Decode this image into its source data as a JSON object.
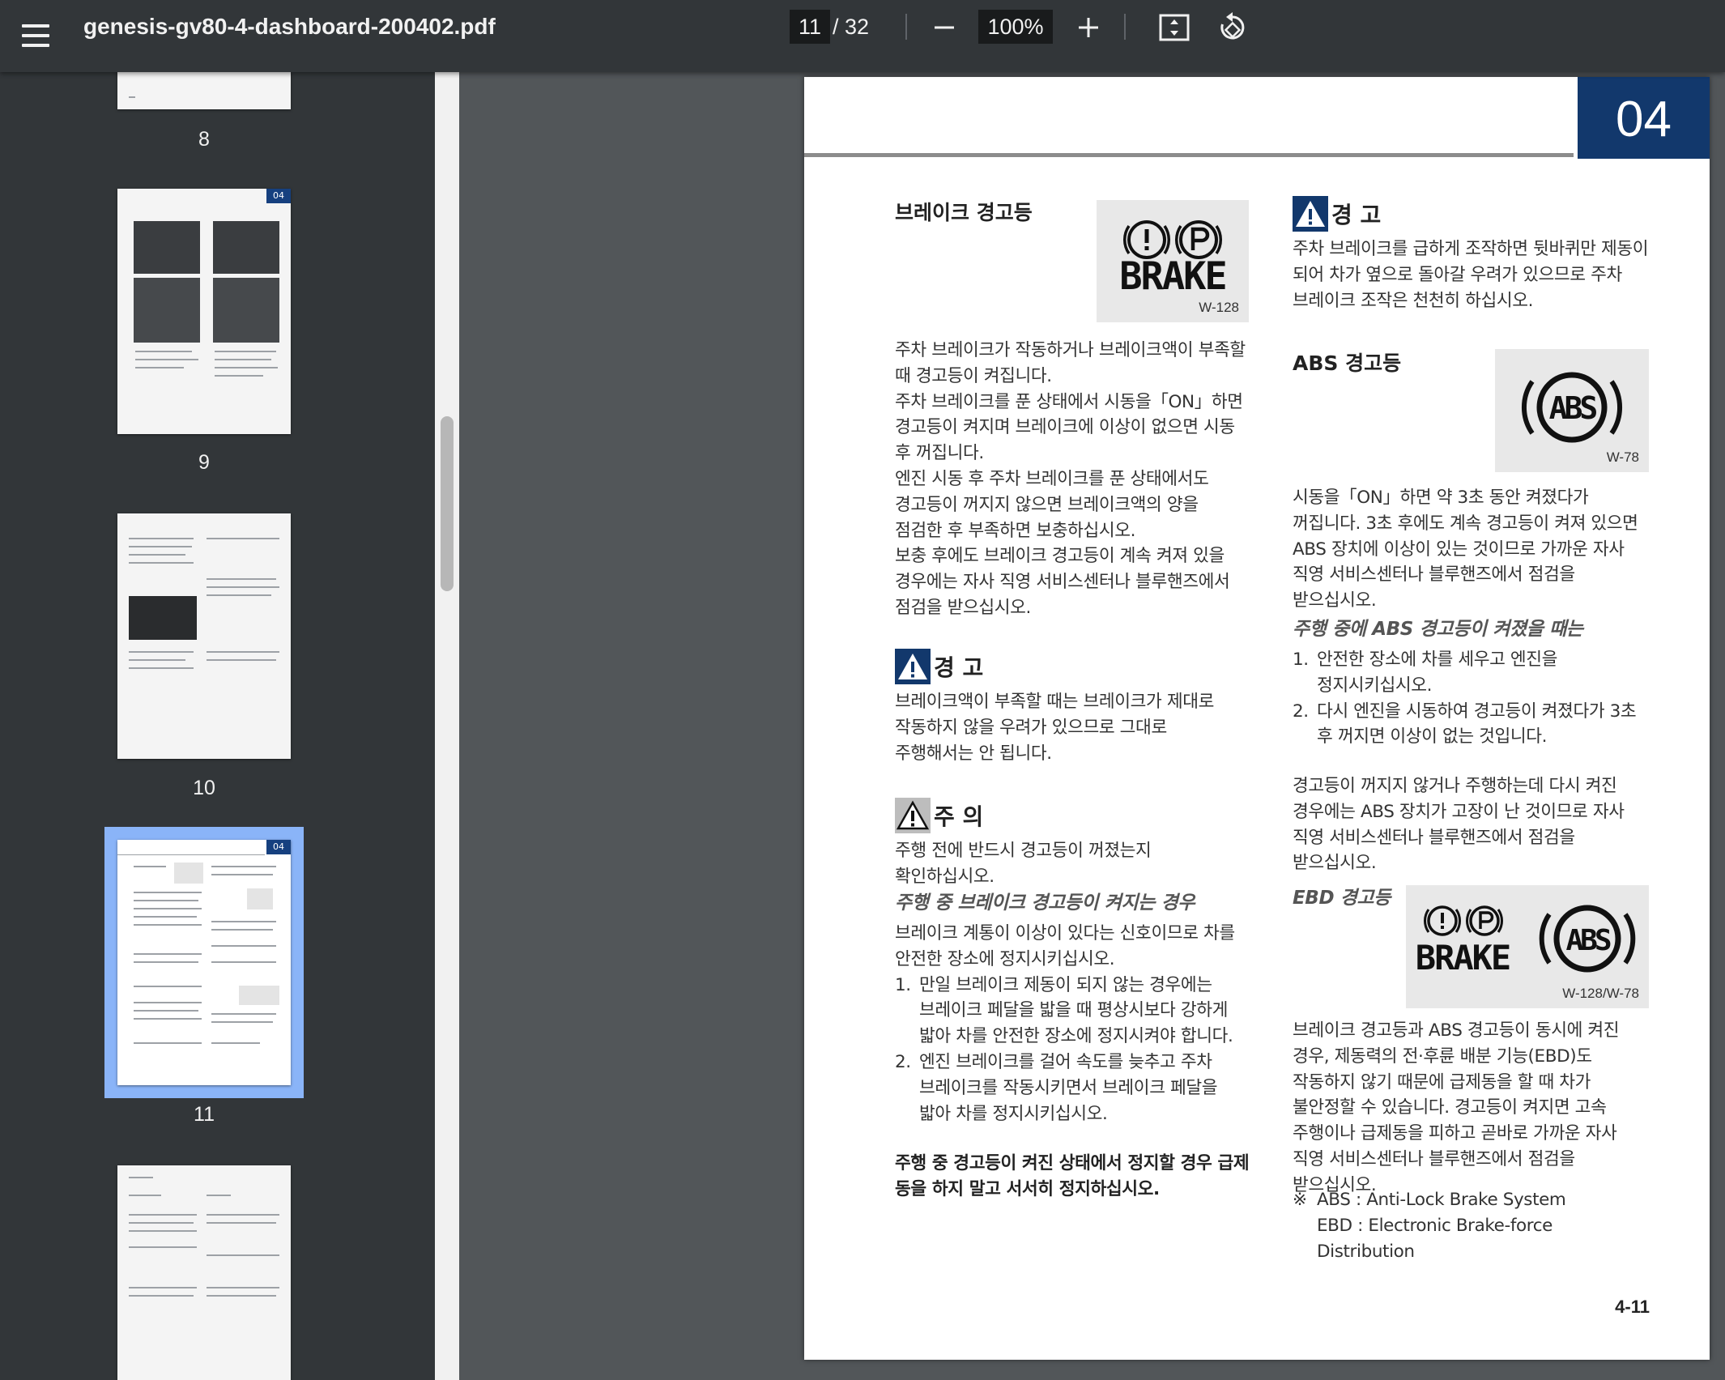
{
  "toolbar": {
    "title": "genesis-gv80-4-dashboard-200402.pdf",
    "current_page": "11",
    "total_pages": "/ 32",
    "zoom": "100%",
    "icons": [
      "menu-icon",
      "minus-icon",
      "plus-icon",
      "fit-page-icon",
      "rotate-icon"
    ]
  },
  "sidebar": {
    "thumbnails": [
      {
        "label": "8"
      },
      {
        "label": "9",
        "badge": "04"
      },
      {
        "label": "10"
      },
      {
        "label": "11",
        "badge": "04",
        "selected": true
      },
      {
        "label": ""
      }
    ]
  },
  "page": {
    "chapter": "04",
    "page_number": "4-11",
    "brake": {
      "title": "브레이크 경고등",
      "icon_text": "BRAKE",
      "icon_code": "W-128",
      "body": [
        "주차 브레이크가 작동하거나 브레이크액이 부족할 때 경고등이 켜집니다.",
        "주차 브레이크를 푼 상태에서 시동을「ON」하면 경고등이 켜지며 브레이크에 이상이 없으면 시동 후 꺼집니다.",
        "엔진 시동 후 주차 브레이크를 푼 상태에서도 경고등이 꺼지지 않으면 브레이크액의 양을 점검한 후 부족하면 보충하십시오.",
        "보충 후에도 브레이크 경고등이 계속 켜져 있을 경우에는 자사 직영 서비스센터나 블루핸즈에서 점검을 받으십시오."
      ]
    },
    "warning_left": {
      "title": "경 고",
      "body": "브레이크액이 부족할 때는 브레이크가 제대로 작동하지 않을 우려가 있으므로 그대로 주행해서는 안 됩니다."
    },
    "caution": {
      "title": "주 의",
      "body": "주행 전에 반드시 경고등이 꺼졌는지 확인하십시오."
    },
    "driving_brake": {
      "title": "주행 중 브레이크 경고등이 켜지는 경우",
      "body": "브레이크 계통이 이상이 있다는 신호이므로 차를 안전한 장소에 정지시키십시오.",
      "items": [
        {
          "num": "1.",
          "text": "만일 브레이크 제동이 되지 않는 경우에는 브레이크 페달을 밟을 때 평상시보다 강하게 밟아 차를 안전한 장소에 정지시켜야 합니다."
        },
        {
          "num": "2.",
          "text": "엔진 브레이크를 걸어 속도를 늦추고 주차 브레이크를 작동시키면서 브레이크 페달을 밟아 차를 정지시키십시오."
        }
      ],
      "bold_note": "주행 중 경고등이 켜진 상태에서 정지할 경우 급제동을 하지 말고 서서히 정지하십시오."
    },
    "warning_right": {
      "title": "경 고",
      "body": "주차 브레이크를 급하게 조작하면 뒷바퀴만 제동이 되어 차가 옆으로 돌아갈 우려가 있으므로 주차 브레이크 조작은 천천히 하십시오."
    },
    "abs": {
      "title": "ABS 경고등",
      "icon_text": "ABS",
      "icon_code": "W-78",
      "body": "시동을「ON」하면 약 3초 동안 켜졌다가 꺼집니다. 3초 후에도 계속 경고등이 켜져 있으면 ABS 장치에 이상이 있는 것이므로 가까운 자사 직영 서비스센터나 블루핸즈에서 점검을 받으십시오.",
      "driving_title": "주행 중에 ABS 경고등이 켜졌을 때는",
      "items": [
        {
          "num": "1.",
          "text": "안전한 장소에 차를 세우고 엔진을 정지시키십시오."
        },
        {
          "num": "2.",
          "text": "다시 엔진을 시동하여 경고등이 켜졌다가 3초 후 꺼지면 이상이 없는 것입니다."
        }
      ],
      "after": "경고등이 꺼지지 않거나 주행하는데 다시 켜진 경우에는 ABS 장치가 고장이 난 것이므로 자사 직영 서비스센터나 블루핸즈에서 점검을 받으십시오."
    },
    "ebd": {
      "title": "EBD 경고등",
      "icon_brake_text": "BRAKE",
      "icon_abs_text": "ABS",
      "icon_code": "W-128/W-78",
      "body": "브레이크 경고등과 ABS 경고등이 동시에 켜진 경우, 제동력의 전·후륜 배분 기능(EBD)도 작동하지 않기 때문에 급제동을 할 때 차가 불안정할 수 있습니다. 경고등이 켜지면 고속 주행이나 급제동을 피하고 곧바로 가까운 자사 직영 서비스센터나 블루핸즈에서 점검을 받으십시오."
    },
    "notes": {
      "mark": "※",
      "abs": "ABS : Anti-Lock Brake System",
      "ebd": "EBD : Electronic Brake-force Distribution"
    }
  },
  "colors": {
    "toolbar_bg": "#323639",
    "viewer_bg": "#525659",
    "chapter_tab": "#12386c",
    "selection": "#8ab4f8"
  }
}
